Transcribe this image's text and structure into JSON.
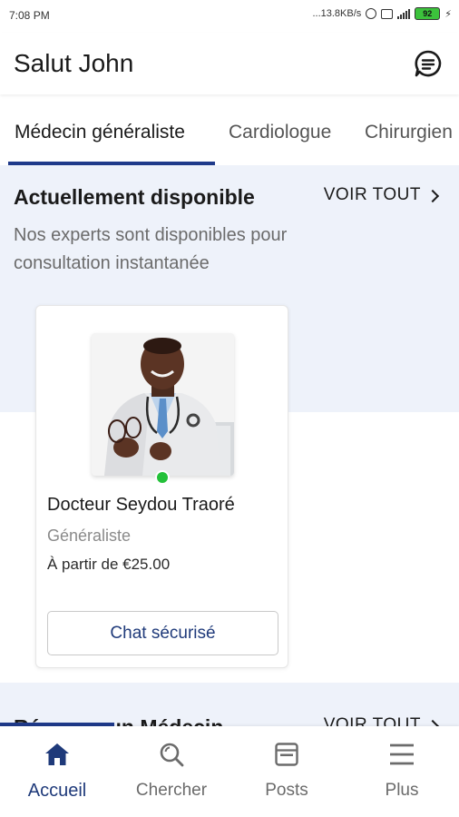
{
  "status_bar": {
    "time": "7:08 PM",
    "network_speed": "...13.8KB/s",
    "battery": "92",
    "icons": [
      "alarm-icon",
      "data-icon",
      "signal-icon",
      "battery-icon",
      "charging-icon"
    ]
  },
  "header": {
    "greeting": "Salut John",
    "chat_icon": "chat-bubble-icon"
  },
  "tabs": [
    {
      "label": "Médecin généraliste",
      "active": true
    },
    {
      "label": "Cardiologue",
      "active": false
    },
    {
      "label": "Chirurgien",
      "active": false
    }
  ],
  "available": {
    "title": "Actuellement disponible",
    "see_all": "VOIR TOUT",
    "description": "Nos experts sont disponibles pour consultation instantanée",
    "doctor": {
      "name": "Docteur Seydou Traoré",
      "specialty": "Généraliste",
      "price": "À partir de €25.00",
      "status": "online",
      "button": "Chat sécurisé"
    }
  },
  "book": {
    "title": "Réserver un Médecin",
    "see_all": "VOIR TOUT"
  },
  "bottom_nav": [
    {
      "label": "Accueil",
      "icon": "home-icon",
      "active": true
    },
    {
      "label": "Chercher",
      "icon": "search-icon",
      "active": false
    },
    {
      "label": "Posts",
      "icon": "posts-icon",
      "active": false
    },
    {
      "label": "Plus",
      "icon": "menu-icon",
      "active": false
    }
  ],
  "colors": {
    "accent": "#1f3a8a",
    "section_bg": "#eef2fa",
    "online": "#24c13a",
    "battery": "#3cc23c"
  }
}
